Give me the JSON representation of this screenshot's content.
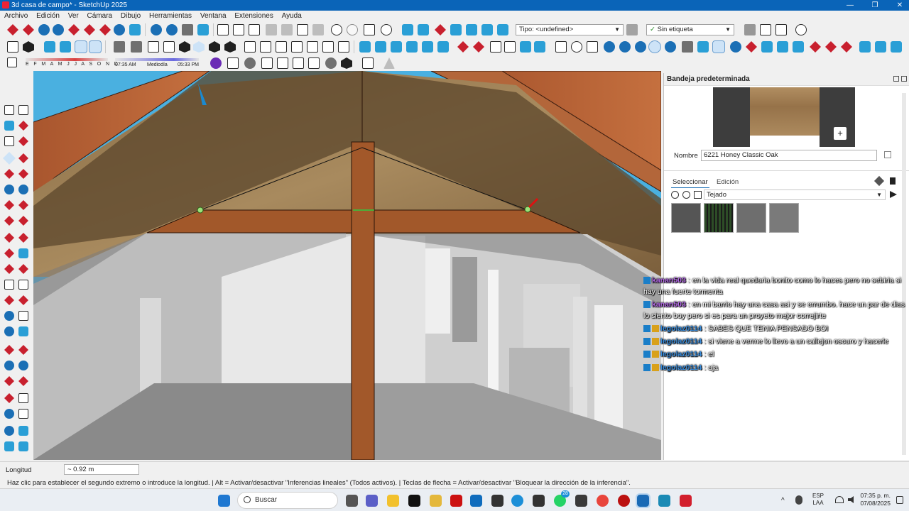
{
  "window": {
    "title": "3d casa de campo* - SketchUp 2025",
    "minimize": "—",
    "maximize": "❐",
    "close": "✕"
  },
  "menu": [
    "Archivo",
    "Edición",
    "Ver",
    "Cámara",
    "Dibujo",
    "Herramientas",
    "Ventana",
    "Extensiones",
    "Ayuda"
  ],
  "toolbar": {
    "type_label": "Tipo: <undefined>",
    "tag_label": "Sin etiqueta",
    "shadow_months": "E F M A M J J A S O N D",
    "shadow_time_start": "07:35 AM",
    "shadow_time_mid": "Mediodía",
    "shadow_time_end": "05:33 PM"
  },
  "tray": {
    "title": "Bandeja predeterminada",
    "name_label": "Nombre",
    "material_name": "6221 Honey Classic Oak",
    "tabs": [
      "Seleccionar",
      "Edición"
    ],
    "collection": "Tejado",
    "swatch_colors": [
      "#555555",
      "#2d4d27",
      "#6e6e6e",
      "#7a7a7a"
    ],
    "preview_color": "#a7865d"
  },
  "chat": [
    {
      "user": "kanan503",
      "text": " : en la vida real quedaria bonito como lo haces pero no sebiria si hay una fuerte tormenta",
      "color": "#b468e8"
    },
    {
      "user": "kanan503",
      "text": " : en mi barrio hay una casa asi y se errumbo. hace un par de dias lo siento boy pero si es para un proyeto mejor correjirte",
      "color": "#b468e8"
    },
    {
      "user": "legolaz0114",
      "text": " : SABES QUE TENIA PENSADO BOI",
      "color": "#3a8fe0"
    },
    {
      "user": "legolaz0114",
      "text": " : si viene a verme lo llevo a un callejon oscuro y hacerle",
      "color": "#3a8fe0"
    },
    {
      "user": "legolaz0114",
      "text": " : el",
      "color": "#3a8fe0"
    },
    {
      "user": "legolaz0114",
      "text": " : aja",
      "color": "#3a8fe0"
    }
  ],
  "status": {
    "measure_label": "Longitud",
    "measure_value": "~ 0.92 m",
    "hint": "Haz clic para establecer el segundo extremo o introduce la longitud. | Alt = Activar/desactivar \"Inferencias lineales\" (Todos activos). | Teclas de flecha = Activar/desactivar \"Bloquear la dirección de la inferencia\"."
  },
  "taskbar": {
    "search_placeholder": "Buscar",
    "lang": "ESP",
    "lang2": "LAA",
    "time": "07:35 p. m.",
    "date": "07/08/2025",
    "notif_count": "28"
  }
}
